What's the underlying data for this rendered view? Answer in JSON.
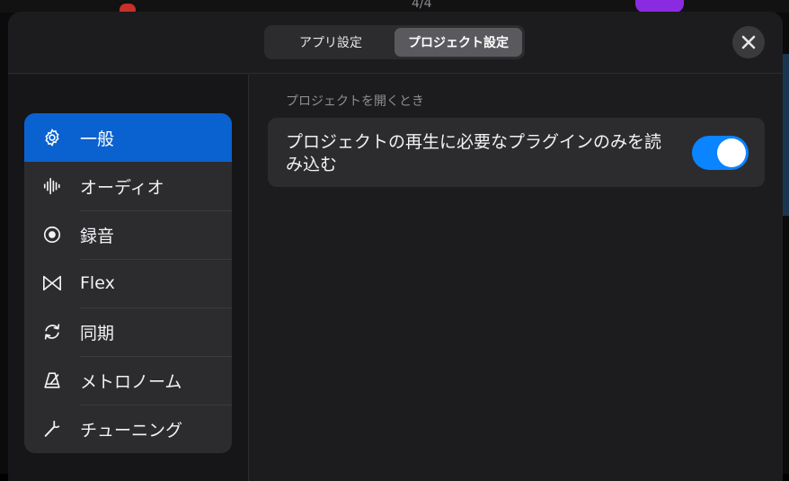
{
  "backdrop": {
    "counter": "4/4"
  },
  "header": {
    "tabs": [
      {
        "label": "アプリ設定",
        "active": false
      },
      {
        "label": "プロジェクト設定",
        "active": true
      }
    ],
    "close_icon": "close-icon"
  },
  "sidebar": {
    "items": [
      {
        "label": "一般",
        "icon": "gear-icon",
        "selected": true
      },
      {
        "label": "オーディオ",
        "icon": "waveform-icon",
        "selected": false
      },
      {
        "label": "録音",
        "icon": "record-icon",
        "selected": false
      },
      {
        "label": "Flex",
        "icon": "flex-icon",
        "selected": false
      },
      {
        "label": "同期",
        "icon": "sync-icon",
        "selected": false
      },
      {
        "label": "メトロノーム",
        "icon": "metronome-icon",
        "selected": false
      },
      {
        "label": "チューニング",
        "icon": "tuning-fork-icon",
        "selected": false
      }
    ]
  },
  "main": {
    "section_title": "プロジェクトを開くとき",
    "setting": {
      "label": "プロジェクトの再生に必要なプラグインのみを読み込む",
      "toggle_on": true
    }
  },
  "colors": {
    "accent": "#0a84ff",
    "selected_row": "#0a62d0",
    "panel": "#1c1c1e",
    "card": "#2c2c2e"
  }
}
